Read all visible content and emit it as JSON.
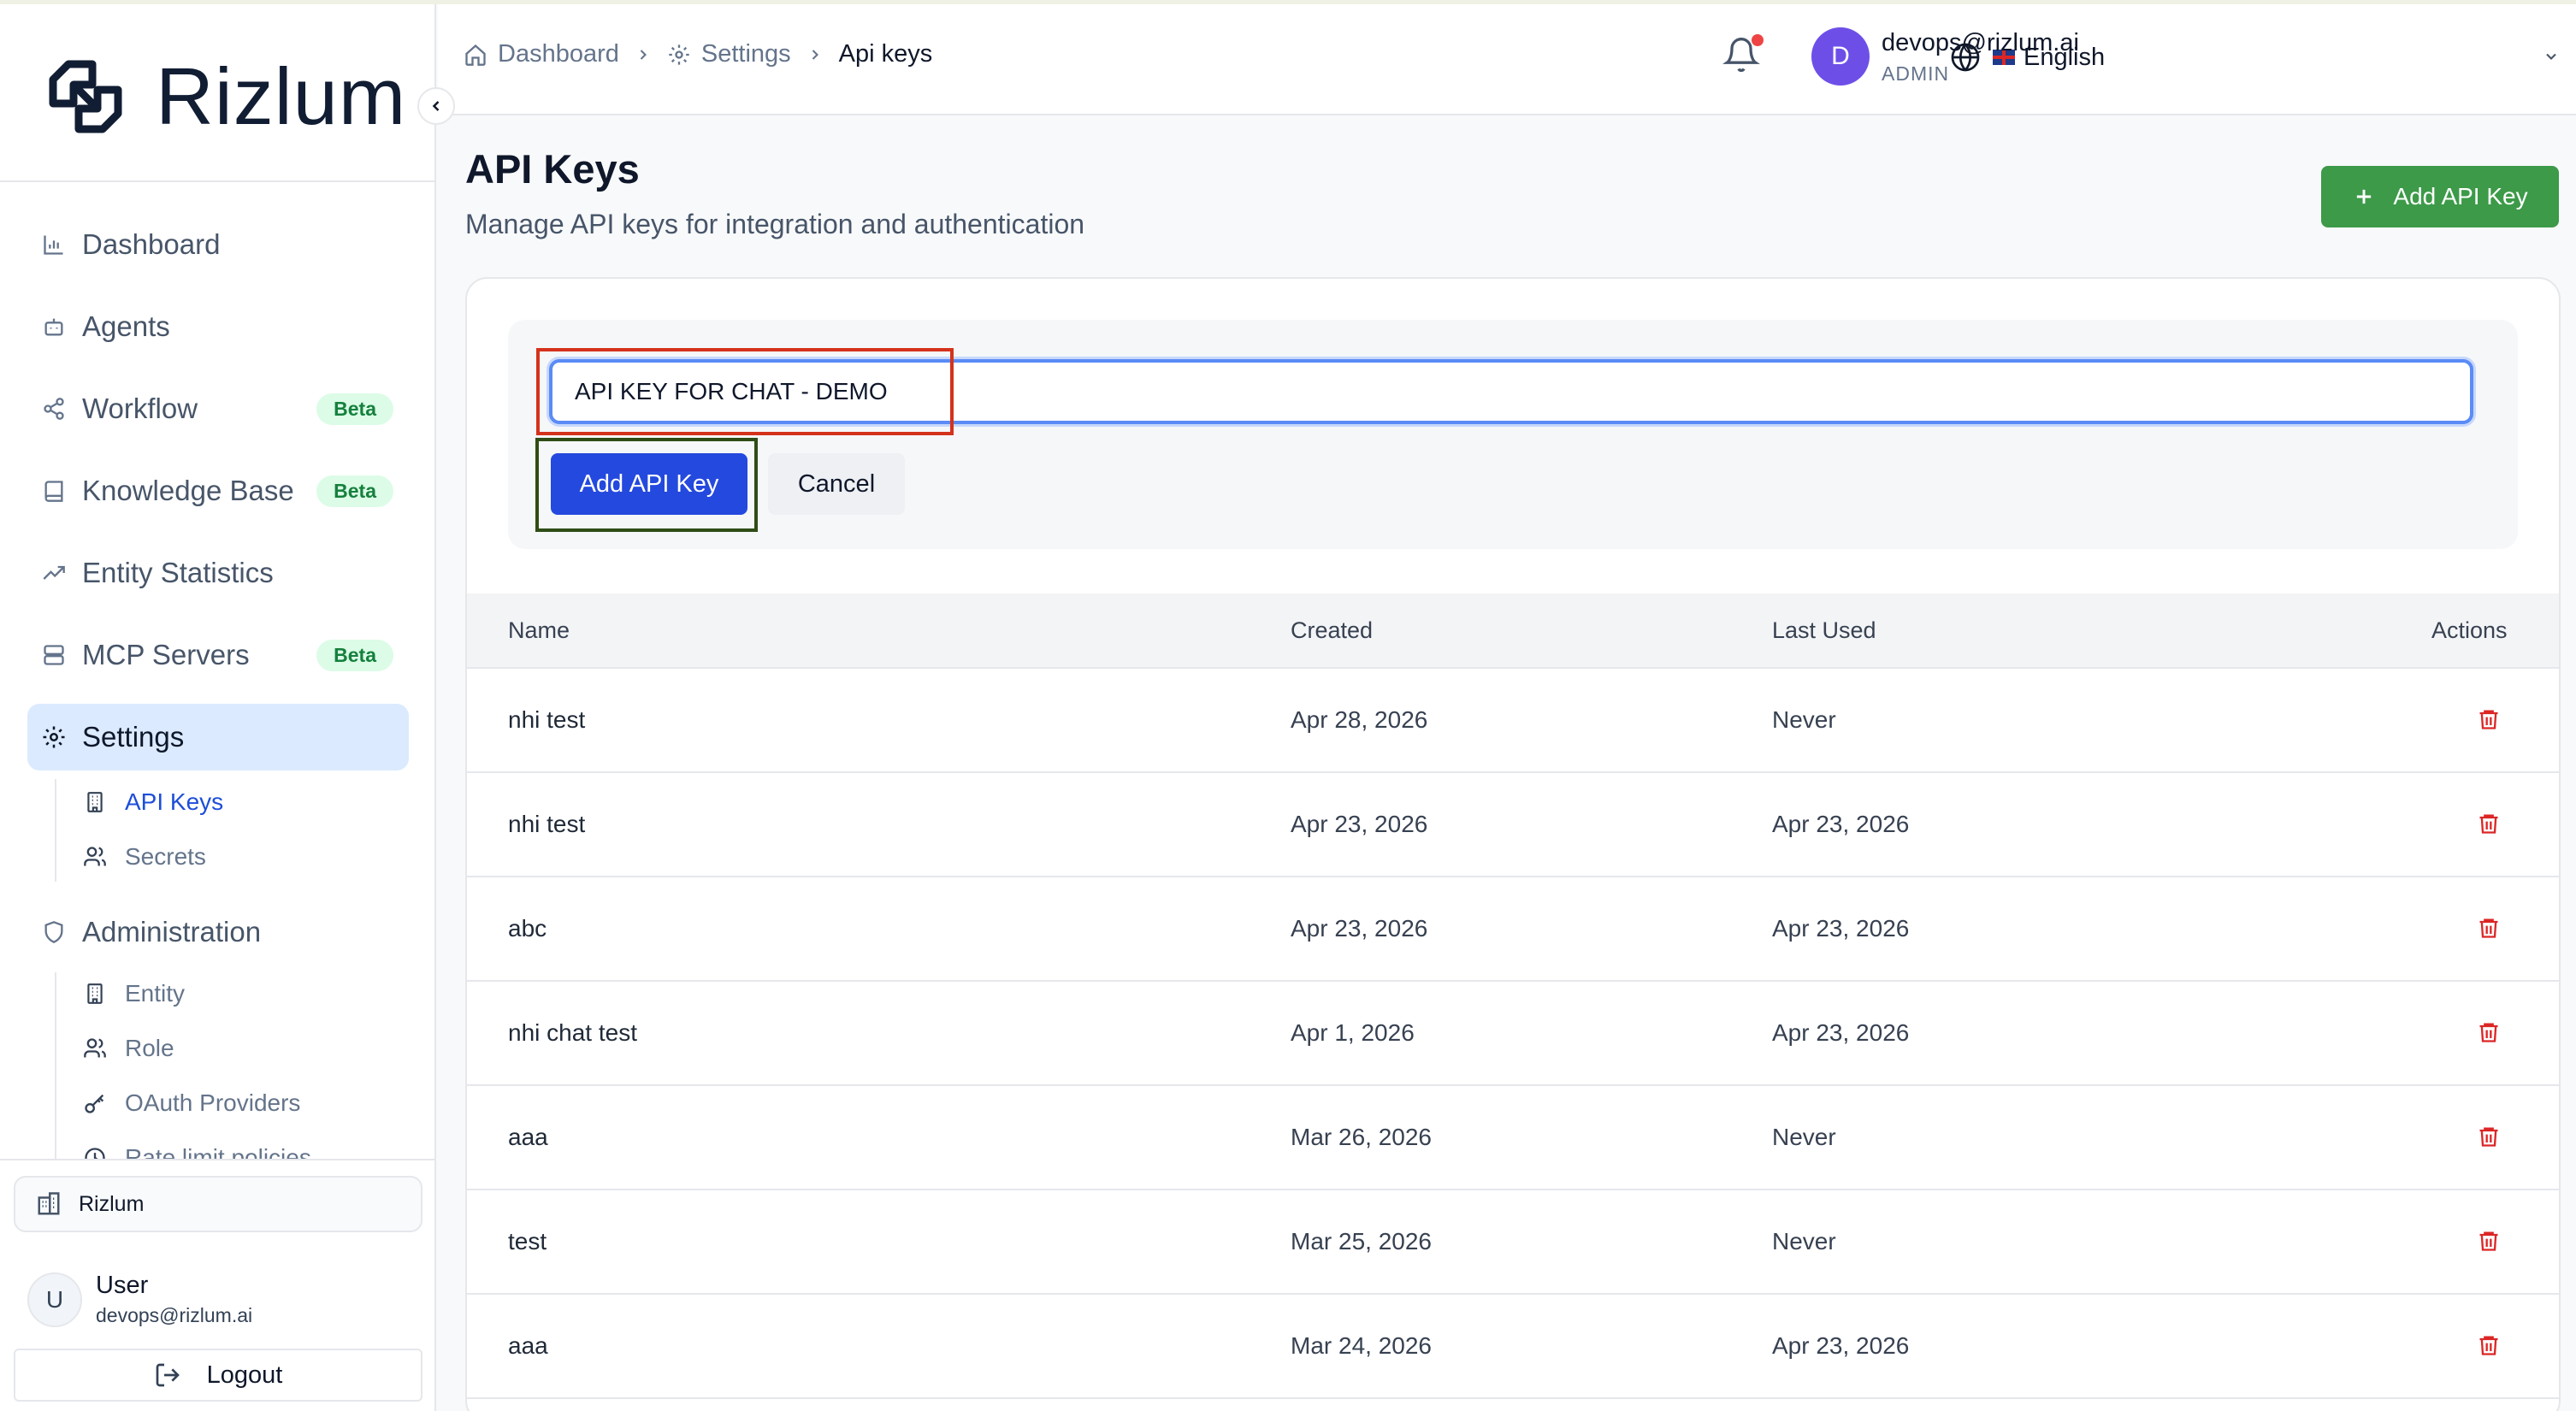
{
  "brand": {
    "name": "Rizlum"
  },
  "sidebar": {
    "nav": [
      {
        "label": "Dashboard",
        "icon": "bar-chart-icon"
      },
      {
        "label": "Agents",
        "icon": "bot-icon"
      },
      {
        "label": "Workflow",
        "icon": "share-icon",
        "badge": "Beta"
      },
      {
        "label": "Knowledge Base",
        "icon": "book-icon",
        "badge": "Beta"
      },
      {
        "label": "Entity Statistics",
        "icon": "trending-up-icon"
      },
      {
        "label": "MCP Servers",
        "icon": "server-icon",
        "badge": "Beta"
      },
      {
        "label": "Settings",
        "icon": "gear-icon",
        "active": true
      }
    ],
    "settings_sub": [
      {
        "label": "API Keys",
        "icon": "building-icon",
        "active": true
      },
      {
        "label": "Secrets",
        "icon": "users-icon"
      }
    ],
    "administration": {
      "label": "Administration",
      "icon": "shield-icon"
    },
    "admin_sub": [
      {
        "label": "Entity",
        "icon": "building-icon"
      },
      {
        "label": "Role",
        "icon": "users-icon"
      },
      {
        "label": "OAuth Providers",
        "icon": "key-icon"
      },
      {
        "label": "Rate limit policies",
        "icon": "clock-icon"
      }
    ],
    "organization": "Rizlum",
    "user": {
      "initial": "U",
      "name": "User",
      "email": "devops@rizlum.ai"
    },
    "logout_label": "Logout"
  },
  "header": {
    "breadcrumb": [
      {
        "label": "Dashboard",
        "icon": "home-icon"
      },
      {
        "label": "Settings",
        "icon": "gear-icon"
      },
      {
        "label": "Api keys"
      }
    ],
    "language": "English",
    "notifications": {
      "has_unread": true
    },
    "account": {
      "initial": "D",
      "email": "devops@rizlum.ai",
      "role": "ADMIN"
    }
  },
  "page": {
    "title": "API Keys",
    "subtitle": "Manage API keys for integration and authentication",
    "add_button": "Add API Key"
  },
  "form": {
    "name_value": "API KEY FOR CHAT - DEMO",
    "submit_label": "Add API Key",
    "cancel_label": "Cancel"
  },
  "table": {
    "columns": [
      "Name",
      "Created",
      "Last Used",
      "Actions"
    ],
    "rows": [
      {
        "name": "nhi test",
        "created": "Apr 28, 2026",
        "last_used": "Never"
      },
      {
        "name": "nhi test",
        "created": "Apr 23, 2026",
        "last_used": "Apr 23, 2026"
      },
      {
        "name": "abc",
        "created": "Apr 23, 2026",
        "last_used": "Apr 23, 2026"
      },
      {
        "name": "nhi chat test",
        "created": "Apr 1, 2026",
        "last_used": "Apr 23, 2026"
      },
      {
        "name": "aaa",
        "created": "Mar 26, 2026",
        "last_used": "Never"
      },
      {
        "name": "test",
        "created": "Mar 25, 2026",
        "last_used": "Never"
      },
      {
        "name": "aaa",
        "created": "Mar 24, 2026",
        "last_used": "Apr 23, 2026"
      }
    ]
  },
  "colors": {
    "primary": "#2449de",
    "success": "#3c9a48",
    "danger": "#dc2626",
    "highlight_red": "#d4321c",
    "highlight_green": "#2f4d16"
  }
}
